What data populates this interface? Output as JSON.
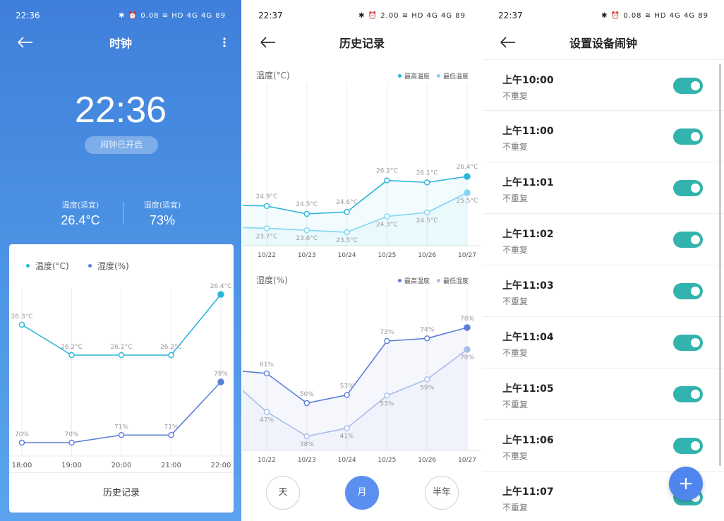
{
  "screen1": {
    "status_time": "22:36",
    "status_icons": "✱ ⏰ 0.08 ≋ HD 4G 4G 89",
    "title": "时钟",
    "clock": "22:36",
    "alarm_pill": "闹钟已开启",
    "temp_label": "温度(适宜)",
    "temp_value": "26.4°C",
    "humid_label": "湿度(适宜)",
    "humid_value": "73%",
    "footer": "历史记录",
    "legend_temp": "温度(°C)",
    "legend_humid": "湿度(%)",
    "colors": {
      "temp": "#29b6dc",
      "humid": "#5b7ed6"
    }
  },
  "screen2": {
    "status_time": "22:37",
    "status_icons": "✱ ⏰ 2.00 ≋ HD 4G 4G 89",
    "title": "历史记录",
    "temp_section": "温度(°C)",
    "humid_section": "湿度(%)",
    "legend_max_temp": "最高温度",
    "legend_min_temp": "最低温度",
    "legend_max_humid": "最高湿度",
    "legend_min_humid": "最低湿度",
    "periods": [
      "天",
      "月",
      "半年"
    ],
    "active_period": "月"
  },
  "screen3": {
    "status_time": "22:37",
    "status_icons": "✱ ⏰ 0.08 ≋ HD 4G 4G 89",
    "title": "设置设备闹钟",
    "alarms": [
      {
        "time": "上午10:00",
        "repeat": "不重复",
        "enabled": true
      },
      {
        "time": "上午11:00",
        "repeat": "不重复",
        "enabled": true
      },
      {
        "time": "上午11:01",
        "repeat": "不重复",
        "enabled": true
      },
      {
        "time": "上午11:02",
        "repeat": "不重复",
        "enabled": true
      },
      {
        "time": "上午11:03",
        "repeat": "不重复",
        "enabled": true
      },
      {
        "time": "上午11:04",
        "repeat": "不重复",
        "enabled": true
      },
      {
        "time": "上午11:05",
        "repeat": "不重复",
        "enabled": true
      },
      {
        "time": "上午11:06",
        "repeat": "不重复",
        "enabled": true
      },
      {
        "time": "上午11:07",
        "repeat": "不重复",
        "enabled": true
      }
    ]
  },
  "chart_data": [
    {
      "type": "line",
      "categories": [
        "18:00",
        "19:00",
        "20:00",
        "21:00",
        "22:00"
      ],
      "series": [
        {
          "name": "温度(°C)",
          "values": [
            26.3,
            26.2,
            26.2,
            26.2,
            26.4
          ],
          "labels": [
            "26.3°C",
            "26.2°C",
            "26.2°C",
            "26.2°C",
            "26.4°C"
          ],
          "color": "#29b6dc"
        },
        {
          "name": "湿度(%)",
          "values": [
            70,
            70,
            71,
            71,
            78
          ],
          "labels": [
            "70%",
            "70%",
            "71%",
            "71%",
            "78%"
          ],
          "color": "#5b7ed6"
        }
      ]
    },
    {
      "type": "area",
      "categories": [
        "10/22",
        "10/23",
        "10/24",
        "10/25",
        "10/26",
        "10/27"
      ],
      "ylabel": "温度(°C)",
      "series": [
        {
          "name": "最高温度",
          "values": [
            24.9,
            24.5,
            24.6,
            26.2,
            26.1,
            26.4
          ],
          "labels": [
            "24.9°C",
            "24.5°C",
            "24.6°C",
            "26.2°C",
            "26.1°C",
            "26.4°C"
          ],
          "color": "#29b6dc"
        },
        {
          "name": "最低温度",
          "values": [
            23.7,
            23.6,
            23.5,
            24.3,
            24.5,
            25.5
          ],
          "labels": [
            "23.7°C",
            "23.6°C",
            "23.5°C",
            "24.3°C",
            "24.5°C",
            "25.5°C"
          ],
          "color": "#7fd6ef"
        }
      ]
    },
    {
      "type": "area",
      "categories": [
        "10/22",
        "10/23",
        "10/24",
        "10/25",
        "10/26",
        "10/27"
      ],
      "ylabel": "湿度(%)",
      "series": [
        {
          "name": "最高湿度",
          "values": [
            61,
            50,
            53,
            73,
            74,
            78
          ],
          "labels": [
            "61%",
            "50%",
            "53%",
            "73%",
            "74%",
            "78%"
          ],
          "color": "#5b7ed6"
        },
        {
          "name": "最低湿度",
          "values": [
            47,
            38,
            41,
            53,
            59,
            70
          ],
          "labels": [
            "47%",
            "38%",
            "41%",
            "53%",
            "59%",
            "70%"
          ],
          "color": "#a9bde8"
        }
      ]
    }
  ]
}
